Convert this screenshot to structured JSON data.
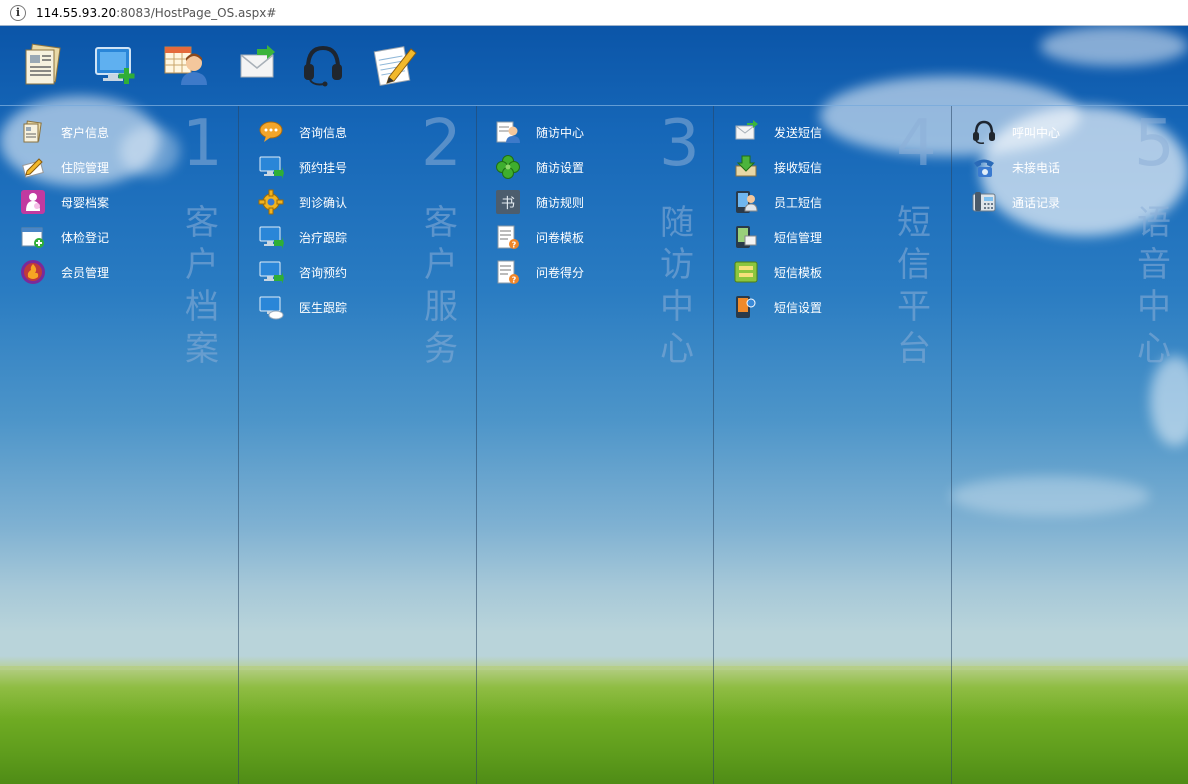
{
  "address_bar": {
    "host": "114.55.93.20",
    "rest": ":8083/HostPage_OS.aspx#"
  },
  "toolbar": {
    "icons": [
      "documents-icon",
      "monitor-add-icon",
      "calendar-person-icon",
      "mail-icon",
      "headset-icon",
      "notepad-pencil-icon"
    ]
  },
  "columns": [
    {
      "number": "1",
      "title": "客户档案",
      "items": [
        {
          "label": "客户信息",
          "icon": "documents-icon"
        },
        {
          "label": "住院管理",
          "icon": "pencil-paper-icon"
        },
        {
          "label": "母婴档案",
          "icon": "mother-baby-icon"
        },
        {
          "label": "体检登记",
          "icon": "form-add-icon"
        },
        {
          "label": "会员管理",
          "icon": "member-badge-icon"
        }
      ]
    },
    {
      "number": "2",
      "title": "客户服务",
      "items": [
        {
          "label": "咨询信息",
          "icon": "chat-bubble-icon"
        },
        {
          "label": "预约挂号",
          "icon": "monitor-arrow-icon"
        },
        {
          "label": "到诊确认",
          "icon": "gear-icon"
        },
        {
          "label": "治疗跟踪",
          "icon": "monitor-arrow-icon"
        },
        {
          "label": "咨询预约",
          "icon": "monitor-arrow-icon"
        },
        {
          "label": "医生跟踪",
          "icon": "monitor-cloud-icon"
        }
      ]
    },
    {
      "number": "3",
      "title": "随访中心",
      "items": [
        {
          "label": "随访中心",
          "icon": "user-card-icon"
        },
        {
          "label": "随访设置",
          "icon": "clover-icon"
        },
        {
          "label": "随访规则",
          "icon": "book-icon"
        },
        {
          "label": "问卷模板",
          "icon": "questionnaire-icon"
        },
        {
          "label": "问卷得分",
          "icon": "questionnaire-icon"
        }
      ]
    },
    {
      "number": "4",
      "title": "短信平台",
      "items": [
        {
          "label": "发送短信",
          "icon": "envelope-send-icon"
        },
        {
          "label": "接收短信",
          "icon": "inbox-arrow-icon"
        },
        {
          "label": "员工短信",
          "icon": "staff-phone-icon"
        },
        {
          "label": "短信管理",
          "icon": "phone-card-icon"
        },
        {
          "label": "短信模板",
          "icon": "template-box-icon"
        },
        {
          "label": "短信设置",
          "icon": "phone-settings-icon"
        }
      ]
    },
    {
      "number": "5",
      "title": "语音中心",
      "items": [
        {
          "label": "呼叫中心",
          "icon": "headset-icon"
        },
        {
          "label": "未接电话",
          "icon": "phone-missed-icon"
        },
        {
          "label": "通话记录",
          "icon": "telephone-icon"
        }
      ]
    }
  ],
  "colors": {
    "sky_top": "#0b55a8",
    "sky_bottom": "#b9d4da",
    "grass": "#6fab23",
    "watermark": "#8cafd7"
  }
}
